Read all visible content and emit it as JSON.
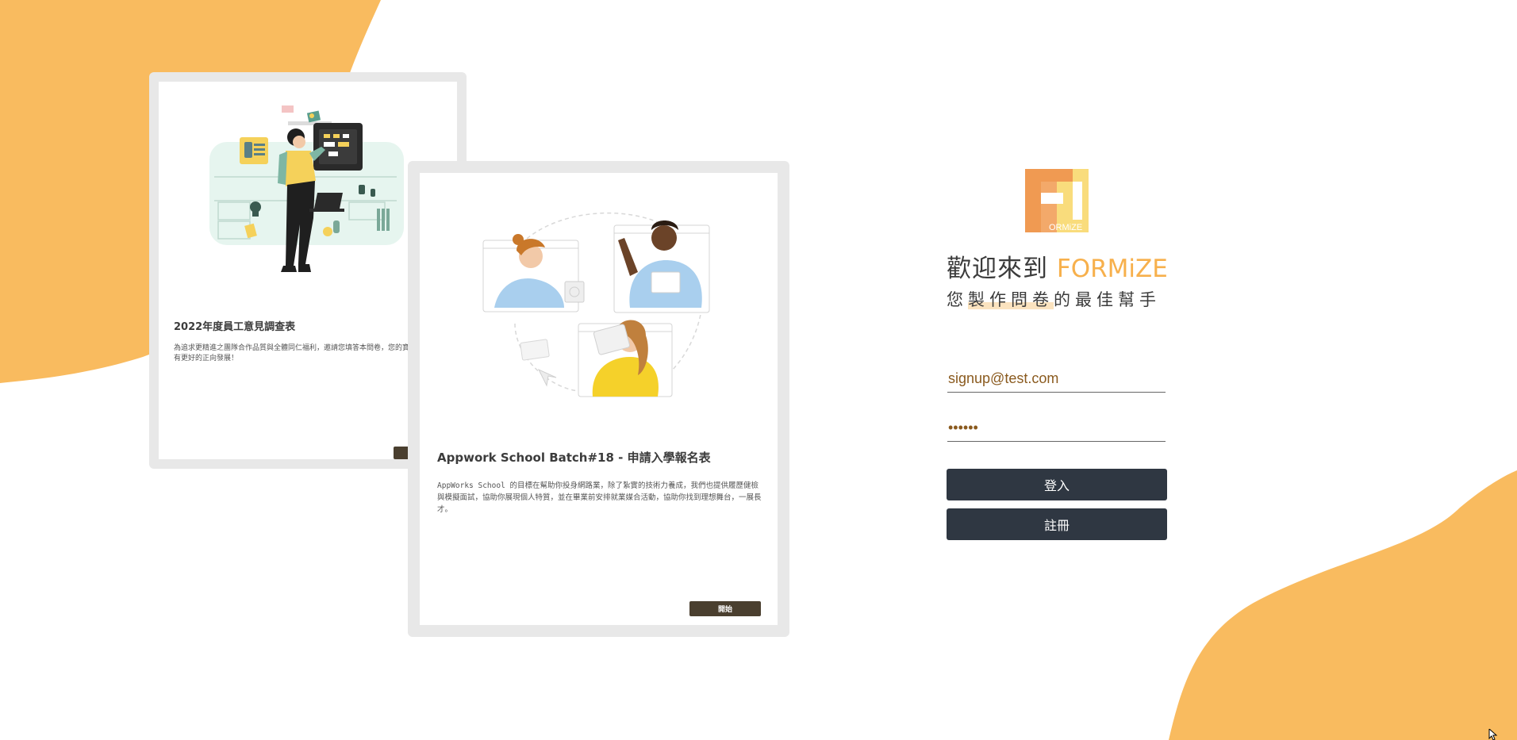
{
  "colors": {
    "accent": "#f9bb5f",
    "brand_text": "#f7b04c",
    "button_dark": "#2f3742",
    "card_button": "#4a3f2f",
    "card_frame": "#e8e8e8"
  },
  "cards": [
    {
      "title": "2022年度員工意見調查表",
      "description": "為追求更精進之團隊合作品質與全體同仁福利，邀請您填答本問卷，您的寶貴意見將使公司有更好的正向發展！",
      "button_label": ""
    },
    {
      "title": "Appwork School Batch#18 - 申請入學報名表",
      "description": "AppWorks School 的目標在幫助你投身網路業，除了紮實的技術力養成，我們也提供履歷健檢與模擬面試，協助你展現個人特質，並在畢業前安排就業媒合活動，協助你找到理想舞台，一展長才。",
      "button_label": "開始"
    }
  ],
  "logo": {
    "letter": "F",
    "wordmark": "ORMiZE"
  },
  "welcome": {
    "prefix": "歡迎來到",
    "brand": "FORMiZE"
  },
  "tagline": {
    "before": "您",
    "highlight": "製作問卷",
    "after": "的最佳幫手"
  },
  "form": {
    "email_value": "signup@test.com",
    "password_value": "••••••",
    "login_label": "登入",
    "signup_label": "註冊"
  },
  "icons": {
    "cursor": "mouse-pointer-icon"
  }
}
